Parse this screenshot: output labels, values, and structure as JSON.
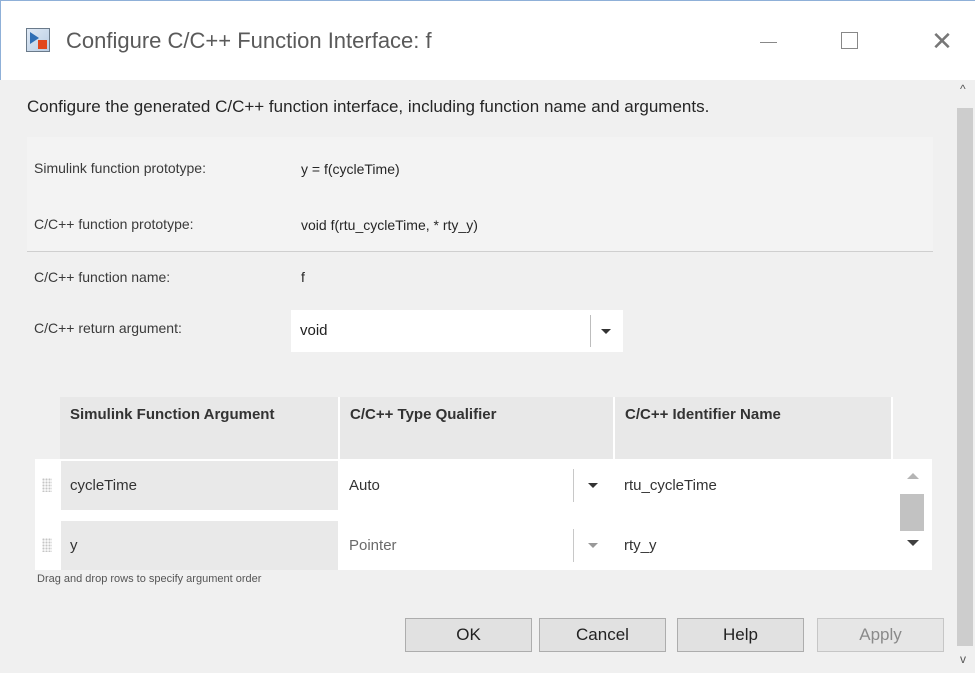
{
  "window": {
    "title": "Configure C/C++ Function Interface: f",
    "minimize_glyph": "—",
    "close_glyph": "✕",
    "icon": "simulink-app-icon"
  },
  "description": "Configure the generated C/C++ function interface, including function name and arguments.",
  "prototypes": {
    "simulink_label": "Simulink function prototype:",
    "simulink_value": "y = f(cycleTime)",
    "c_label": "C/C++ function prototype:",
    "c_value": "void f(rtu_cycleTime, * rty_y)"
  },
  "function_name": {
    "label": "C/C++ function name:",
    "value": "f"
  },
  "return_argument": {
    "label": "C/C++ return argument:",
    "value": "void",
    "icon": "chevron-down-icon"
  },
  "table": {
    "headers": [
      "Simulink Function Argument",
      "C/C++ Type Qualifier",
      "C/C++ Identifier Name"
    ],
    "rows": [
      {
        "argument": "cycleTime",
        "qualifier": "Auto",
        "identifier": "rtu_cycleTime"
      },
      {
        "argument": "y",
        "qualifier": "Pointer",
        "identifier": "rty_y"
      }
    ]
  },
  "hint": "Drag and drop rows to specify argument order",
  "buttons": {
    "ok": "OK",
    "cancel": "Cancel",
    "help": "Help",
    "apply": "Apply"
  },
  "scrollbar": {
    "up_glyph": "^",
    "down_glyph": "v"
  }
}
